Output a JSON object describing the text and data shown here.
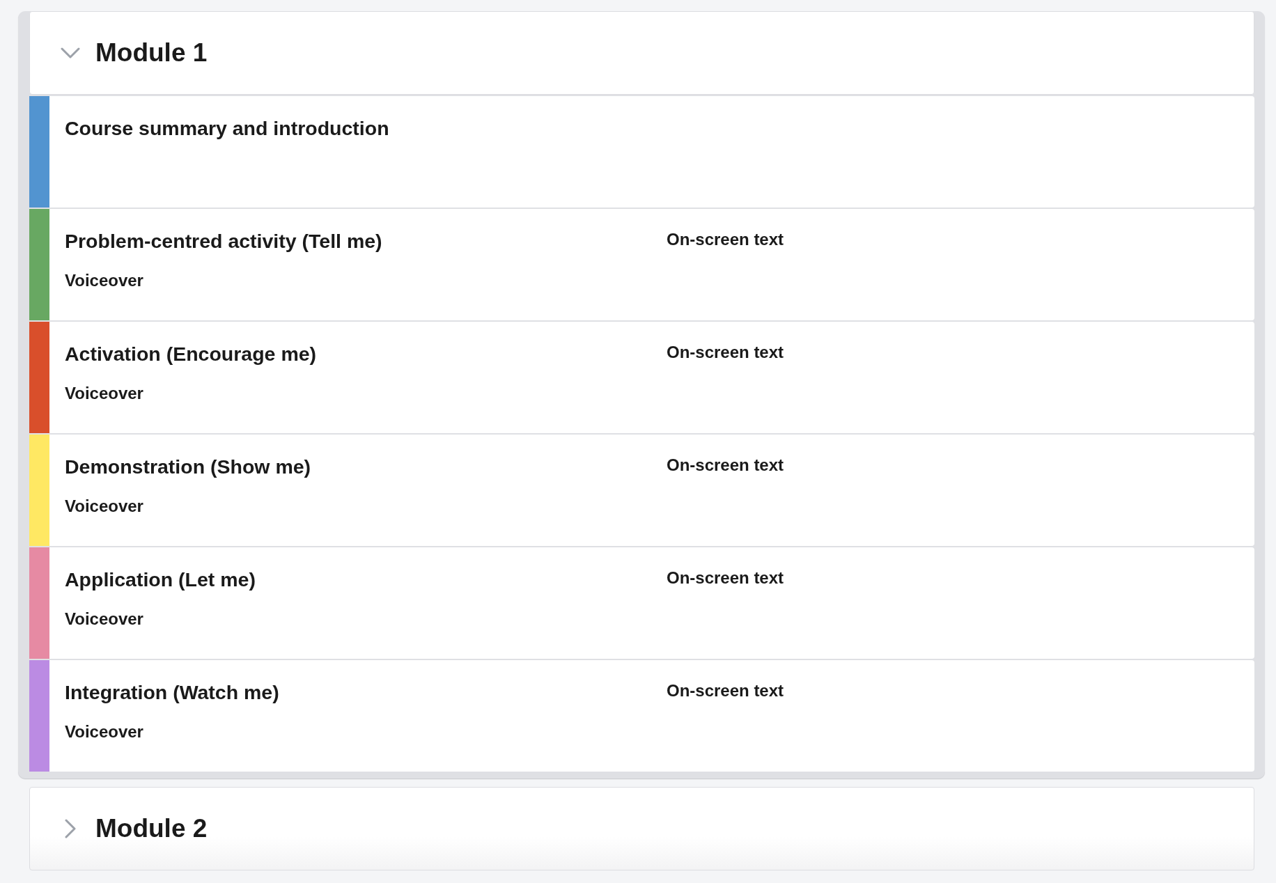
{
  "modules": [
    {
      "title": "Module 1",
      "expanded": true,
      "sections": [
        {
          "title": "Course summary and introduction",
          "color": "#5294d0"
        },
        {
          "title": "Problem-centred activity (Tell me)",
          "color": "#68a862",
          "voiceover": "Voiceover",
          "onscreen": "On-screen text"
        },
        {
          "title": "Activation (Encourage me)",
          "color": "#d94f2b",
          "voiceover": "Voiceover",
          "onscreen": "On-screen text"
        },
        {
          "title": "Demonstration (Show me)",
          "color": "#ffe863",
          "voiceover": "Voiceover",
          "onscreen": "On-screen text"
        },
        {
          "title": "Application (Let me)",
          "color": "#e68aa3",
          "voiceover": "Voiceover",
          "onscreen": "On-screen text"
        },
        {
          "title": "Integration (Watch me)",
          "color": "#bb8be3",
          "voiceover": "Voiceover",
          "onscreen": "On-screen text"
        }
      ]
    },
    {
      "title": "Module 2",
      "expanded": false
    }
  ]
}
